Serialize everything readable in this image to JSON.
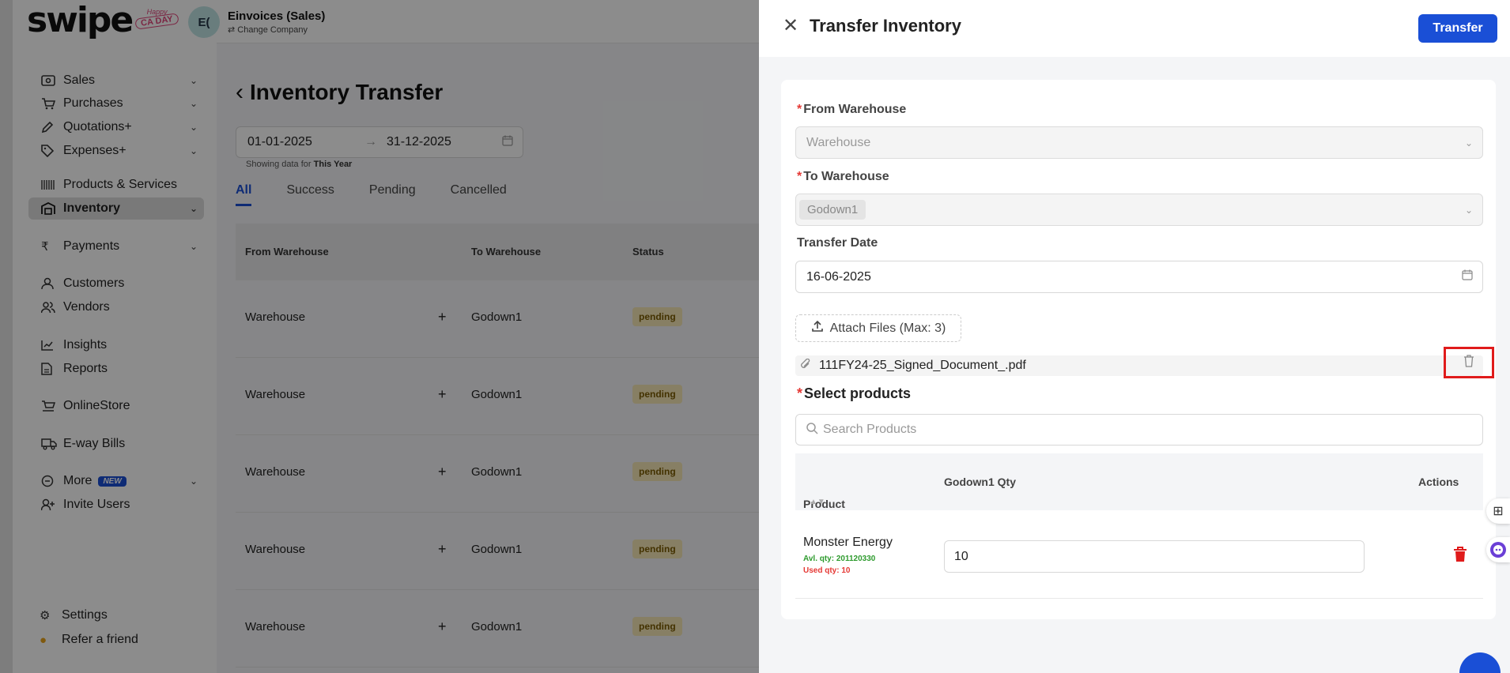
{
  "brand": {
    "logo_text": "swipe",
    "badge_top": "Happy",
    "badge_main": "CA DAY"
  },
  "company": {
    "initials": "E(",
    "name": "Einvoices (Sales)",
    "switch_label": "Change Company"
  },
  "sidebar": {
    "items": [
      {
        "label": "Sales",
        "icon": "cash-icon"
      },
      {
        "label": "Purchases",
        "icon": "cart-icon"
      },
      {
        "label": "Quotations+",
        "icon": "pen-icon"
      },
      {
        "label": "Expenses+",
        "icon": "tag-icon"
      },
      {
        "label": "Products & Services",
        "icon": "barcode-icon"
      },
      {
        "label": "Inventory",
        "icon": "warehouse-icon"
      },
      {
        "label": "Payments",
        "icon": "rupee-icon"
      },
      {
        "label": "Customers",
        "icon": "user-icon"
      },
      {
        "label": "Vendors",
        "icon": "users-icon"
      },
      {
        "label": "Insights",
        "icon": "chart-icon"
      },
      {
        "label": "Reports",
        "icon": "report-icon"
      },
      {
        "label": "OnlineStore",
        "icon": "store-icon"
      },
      {
        "label": "E-way Bills",
        "icon": "truck-icon"
      },
      {
        "label": "More",
        "icon": "more-icon",
        "badge": "NEW"
      },
      {
        "label": "Invite Users",
        "icon": "user-plus-icon"
      },
      {
        "label": "Settings",
        "icon": "gear-icon"
      },
      {
        "label": "Refer a friend",
        "icon": "handshake-icon"
      }
    ]
  },
  "page": {
    "title": "Inventory Transfer",
    "date_from": "01-01-2025",
    "date_to": "31-12-2025",
    "showing_prefix": "Showing data for",
    "showing_period": "This Year",
    "tabs": [
      "All",
      "Success",
      "Pending",
      "Cancelled"
    ],
    "active_tab": "All",
    "columns": [
      "From Warehouse",
      "To Warehouse",
      "Status"
    ],
    "rows": [
      {
        "from": "Warehouse",
        "to": "Godown1",
        "status": "pending"
      },
      {
        "from": "Warehouse",
        "to": "Godown1",
        "status": "pending"
      },
      {
        "from": "Warehouse",
        "to": "Godown1",
        "status": "pending"
      },
      {
        "from": "Warehouse",
        "to": "Godown1",
        "status": "pending"
      },
      {
        "from": "Warehouse",
        "to": "Godown1",
        "status": "pending"
      }
    ]
  },
  "drawer": {
    "title": "Transfer Inventory",
    "submit_label": "Transfer",
    "from_label": "From Warehouse",
    "from_placeholder": "Warehouse",
    "to_label": "To Warehouse",
    "to_value": "Godown1",
    "date_label": "Transfer Date",
    "date_value": "16-06-2025",
    "attach_label": "Attach Files (Max: 3)",
    "file_name": "111FY24-25_Signed_Document_.pdf",
    "products_label": "Select products",
    "search_placeholder": "Search Products",
    "table_headers": {
      "product": "Product",
      "qty": "Godown1 Qty",
      "actions": "Actions"
    },
    "products": [
      {
        "name": "Monster Energy",
        "avl": "Avl. qty: 201120330",
        "used": "Used qty: 10",
        "qty": "10"
      }
    ]
  },
  "colors": {
    "primary": "#1a4fd6",
    "danger": "#e01b1b",
    "pending_bg": "#f6e7b7",
    "success_text": "#2e9b2e"
  }
}
